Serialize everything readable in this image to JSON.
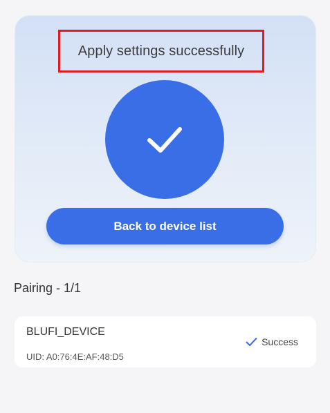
{
  "result": {
    "title": "Apply settings successfully",
    "icon": "checkmark-icon",
    "accent_color": "#3a6ee6",
    "highlight_color": "#e21b23"
  },
  "actions": {
    "back_label": "Back to device list"
  },
  "pairing": {
    "title": "Pairing - 1/1",
    "devices": [
      {
        "name": "BLUFI_DEVICE",
        "uid": "UID: A0:76:4E:AF:48:D5",
        "status": "Success",
        "status_icon": "check-icon"
      }
    ]
  }
}
